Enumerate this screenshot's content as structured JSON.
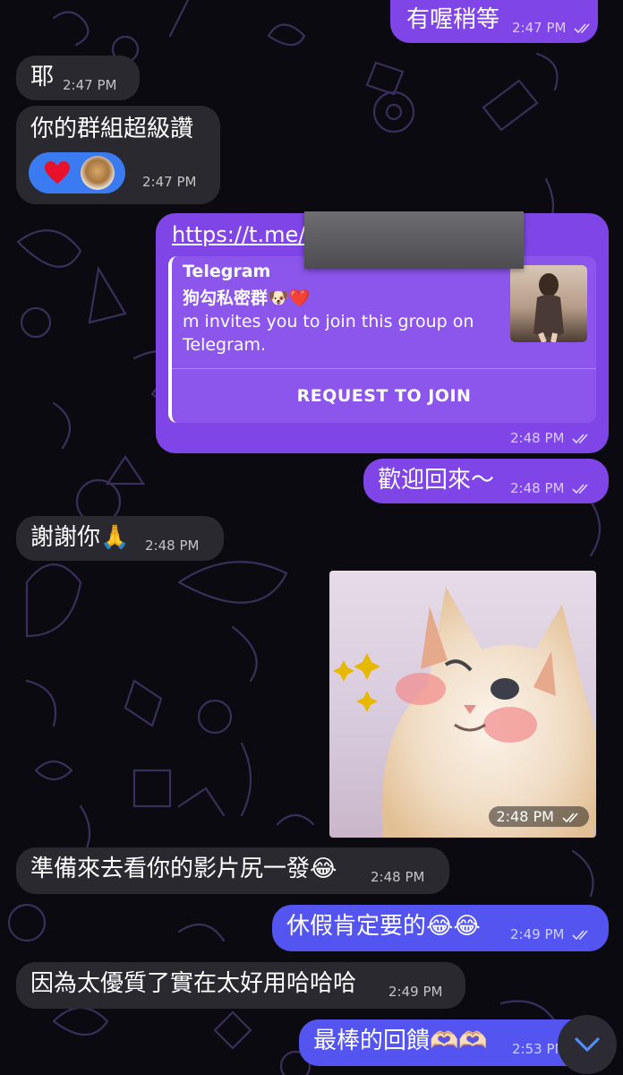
{
  "messages": [
    {
      "id": "m1",
      "dir": "out",
      "text": "有喔稍等",
      "time": "2:47 PM"
    },
    {
      "id": "m2",
      "dir": "in",
      "text": "耶",
      "time": "2:47 PM"
    },
    {
      "id": "m3",
      "dir": "in",
      "text": "你的群組超級讚",
      "time": "2:47 PM",
      "reactions": [
        "heart",
        "avatar"
      ]
    },
    {
      "id": "m4",
      "dir": "out",
      "link": "https://t.me/",
      "time": "2:48 PM",
      "preview": {
        "site": "Telegram",
        "group": "狗勾私密群🐶❤️",
        "description": "m invites you to join this group on Telegram.",
        "button": "REQUEST TO JOIN"
      }
    },
    {
      "id": "m5",
      "dir": "out",
      "text": "歡迎回來～",
      "time": "2:48 PM"
    },
    {
      "id": "m6",
      "dir": "in",
      "text": "謝謝你🙏",
      "time": "2:48 PM"
    },
    {
      "id": "m7",
      "dir": "out",
      "type": "photo",
      "subject": "winking cat",
      "time": "2:48 PM"
    },
    {
      "id": "m8",
      "dir": "in",
      "text": "準備來去看你的影片尻一發😂",
      "time": "2:48 PM"
    },
    {
      "id": "m9",
      "dir": "out",
      "text": "休假肯定要的😂😂",
      "time": "2:49 PM"
    },
    {
      "id": "m10",
      "dir": "in",
      "text": "因為太優質了實在太好用哈哈哈",
      "time": "2:49 PM"
    },
    {
      "id": "m11",
      "dir": "out",
      "text": "最棒的回饋🫶🏻🫶🏻",
      "time": "2:53 PM"
    }
  ],
  "icons": {
    "read": "double-check-icon",
    "scroll": "chevron-down-icon"
  },
  "colors": {
    "background": "#0b0a10",
    "incoming": "#2a2930",
    "outgoing_purple": "#7f45e6",
    "outgoing_blue": "#5454f0",
    "reaction": "#3a7bf1"
  }
}
